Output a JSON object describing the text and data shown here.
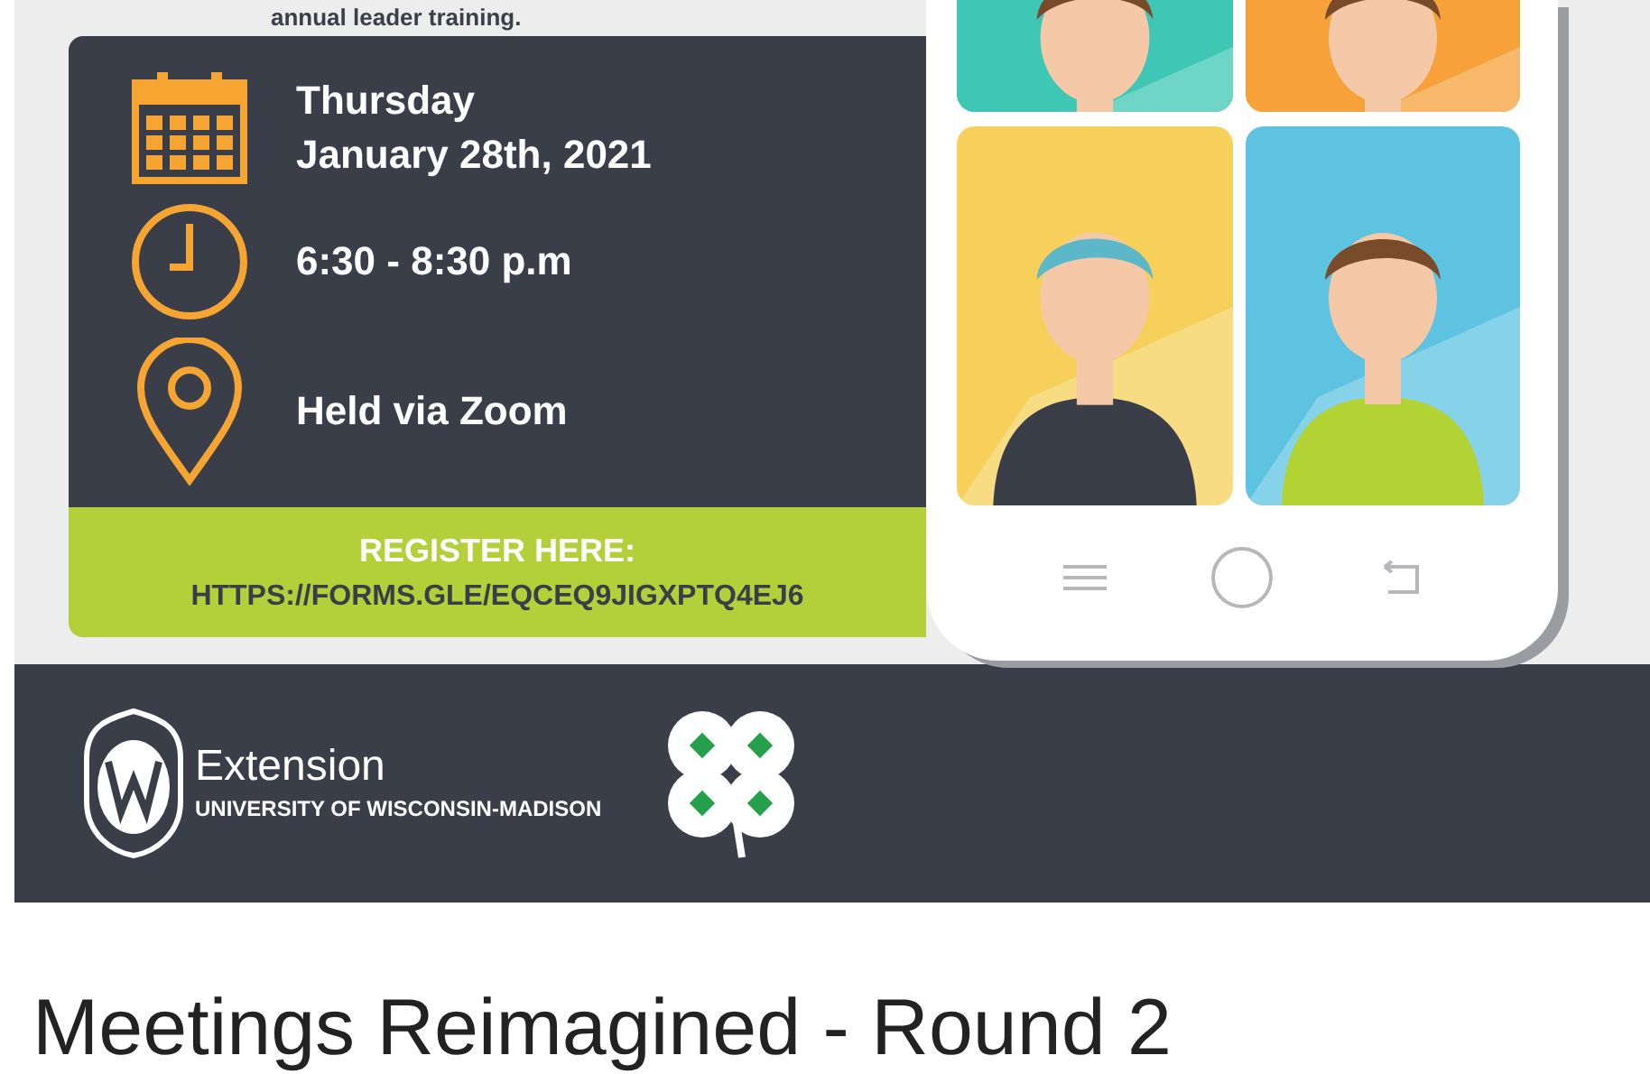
{
  "flyer": {
    "intro_fragment": "annual leader training.",
    "details": [
      {
        "kind": "date",
        "lines": [
          "Thursday",
          "January 28th, 2021"
        ]
      },
      {
        "kind": "time",
        "lines": [
          "6:30 - 8:30 p.m"
        ]
      },
      {
        "kind": "location",
        "lines": [
          "Held via Zoom"
        ]
      }
    ],
    "register": {
      "label": "REGISTER HERE:",
      "url": "HTTPS://FORMS.GLE/EQCEQ9JIGXPTQ4EJ6"
    },
    "footer": {
      "name": "Extension",
      "university": "UNIVERSITY OF WISCONSIN-MADISON"
    }
  },
  "page_title": "Meetings Reimagined - Round 2"
}
